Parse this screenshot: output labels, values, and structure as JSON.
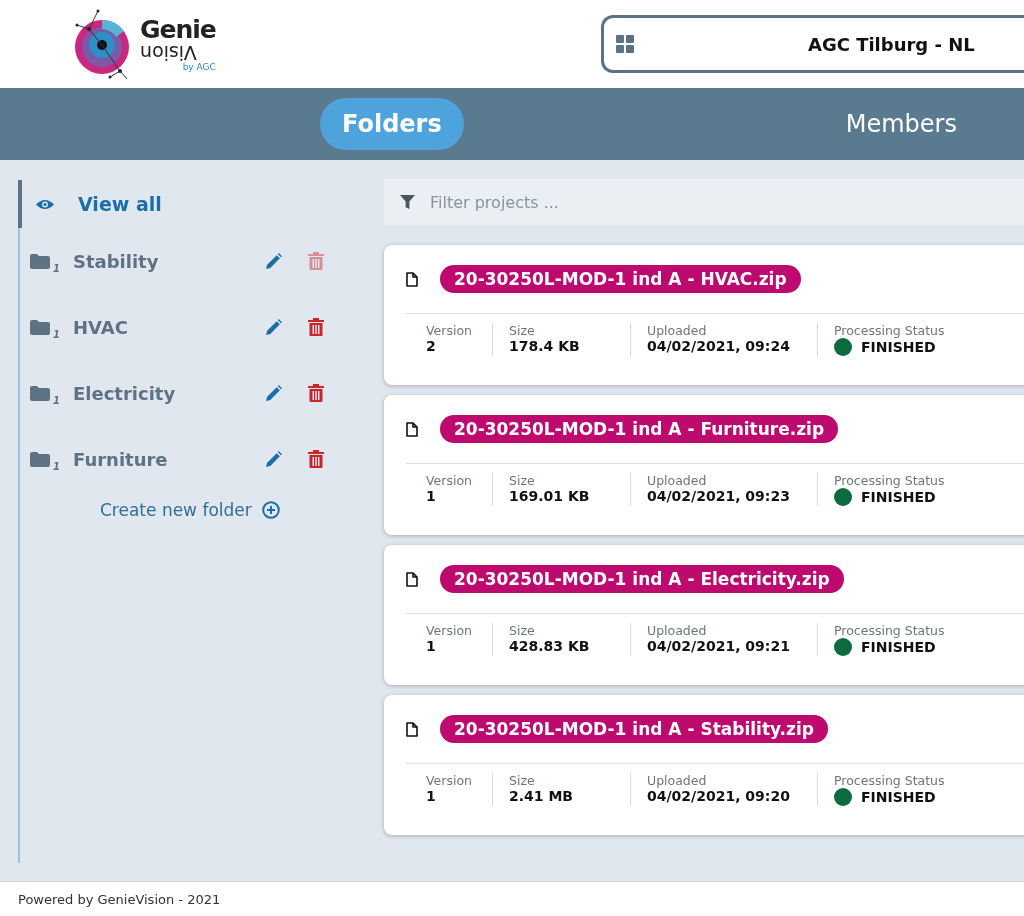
{
  "logo": {
    "word_top": "Genie",
    "word_bottom": "Vision",
    "byline": "by AGC"
  },
  "site_selector": {
    "value": "AGC Tilburg - NL"
  },
  "tabs": [
    {
      "label": "Folders",
      "selected": true
    },
    {
      "label": "Members",
      "selected": false
    }
  ],
  "sidebar": {
    "view_all": {
      "label": "View all",
      "selected": true
    },
    "folders": [
      {
        "name": "Stability",
        "count": "1",
        "delete_disabled": true
      },
      {
        "name": "HVAC",
        "count": "1",
        "delete_disabled": false
      },
      {
        "name": "Electricity",
        "count": "1",
        "delete_disabled": false
      },
      {
        "name": "Furniture",
        "count": "1",
        "delete_disabled": false
      }
    ],
    "create_label": "Create new folder"
  },
  "filter": {
    "placeholder": "Filter projects ..."
  },
  "files": [
    {
      "name": "20-30250L-MOD-1 ind A - HVAC.zip",
      "labels": {
        "version": "Version",
        "size": "Size",
        "uploaded": "Uploaded",
        "status": "Processing Status"
      },
      "version": "2",
      "size": "178.4 KB",
      "uploaded": "04/02/2021, 09:24",
      "status": "FINISHED",
      "color": "#0e6b3f"
    },
    {
      "name": "20-30250L-MOD-1 ind A - Furniture.zip",
      "labels": {
        "version": "Version",
        "size": "Size",
        "uploaded": "Uploaded",
        "status": "Processing Status"
      },
      "version": "1",
      "size": "169.01 KB",
      "uploaded": "04/02/2021, 09:23",
      "status": "FINISHED",
      "color": "#0e6b3f"
    },
    {
      "name": "20-30250L-MOD-1 ind A - Electricity.zip",
      "labels": {
        "version": "Version",
        "size": "Size",
        "uploaded": "Uploaded",
        "status": "Processing Status"
      },
      "version": "1",
      "size": "428.83 KB",
      "uploaded": "04/02/2021, 09:21",
      "status": "FINISHED",
      "color": "#0e6b3f"
    },
    {
      "name": "20-30250L-MOD-1 ind A - Stability.zip",
      "labels": {
        "version": "Version",
        "size": "Size",
        "uploaded": "Uploaded",
        "status": "Processing Status"
      },
      "version": "1",
      "size": "2.41 MB",
      "uploaded": "04/02/2021, 09:20",
      "status": "FINISHED",
      "color": "#0e6b3f"
    }
  ],
  "footer": "Powered by GenieVision - 2021"
}
